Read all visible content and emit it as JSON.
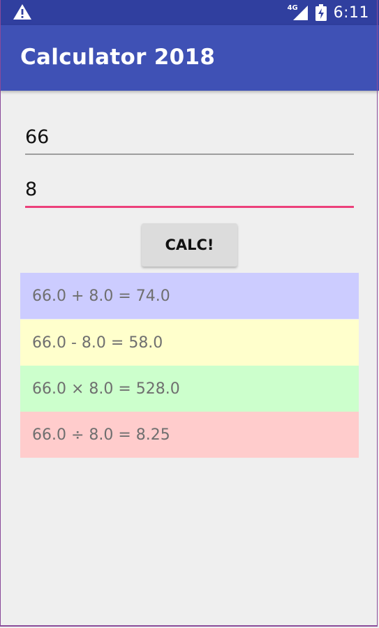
{
  "status_bar": {
    "network": "4G",
    "time": "6:11",
    "warning_icon": "warning-icon",
    "signal_icon": "signal-icon",
    "battery_icon": "battery-charging-icon",
    "background": "#303f9f"
  },
  "app_bar": {
    "title": "Calculator 2018",
    "background": "#3f51b5"
  },
  "inputs": {
    "first_value": "66",
    "second_value": "8",
    "focus_color": "#ec407a"
  },
  "button": {
    "label": "CALC!"
  },
  "results": [
    {
      "text": "66.0 + 8.0 = 74.0",
      "color": "#ccccff"
    },
    {
      "text": "66.0 - 8.0 = 58.0",
      "color": "#ffffcc"
    },
    {
      "text": "66.0 × 8.0 = 528.0",
      "color": "#ccffcc"
    },
    {
      "text": "66.0 ÷ 8.0 = 8.25",
      "color": "#ffcccc"
    }
  ]
}
